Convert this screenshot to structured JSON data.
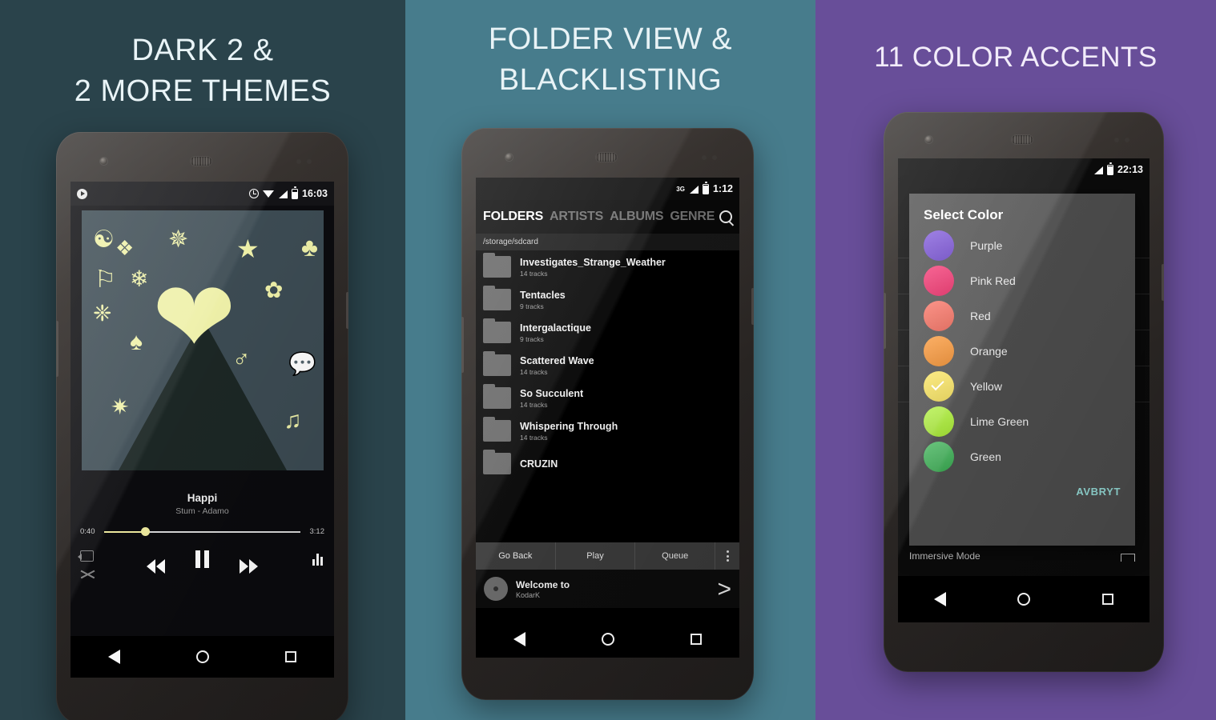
{
  "panels": [
    {
      "id": "themes",
      "bg": "#2a434b",
      "title_lines": [
        "DARK 2 &",
        "2 MORE THEMES"
      ]
    },
    {
      "id": "folders",
      "bg": "#477c8c",
      "title_lines": [
        "FOLDER VIEW &",
        "BLACKLISTING"
      ]
    },
    {
      "id": "accents",
      "bg": "#684e99",
      "title_lines": [
        "11 COLOR ACCENTS"
      ]
    }
  ],
  "phone1": {
    "statusbar": {
      "left_icon": "play-badge-icon",
      "icons": [
        "alarm-icon",
        "wifi-icon",
        "signal-icon",
        "battery-icon"
      ],
      "time": "16:03"
    },
    "album_art": {
      "bg": "#3c4b53",
      "accent": "#eef0a8",
      "symbols": [
        "☯",
        "❖",
        "☀",
        "★",
        "♣",
        "⚑",
        "✿",
        "❀",
        "✤",
        "♠",
        "♂",
        "●",
        "✹",
        "♫"
      ]
    },
    "track": {
      "title": "Happi",
      "artist": "Stum - Adamo",
      "elapsed": "0:40",
      "duration": "3:12",
      "progress_percent": 21
    },
    "controls": {
      "repeat": "repeat-icon",
      "shuffle": "shuffle-icon",
      "previous": "previous-icon",
      "playpause": "pause-icon",
      "next": "next-icon",
      "equalizer": "equalizer-icon"
    },
    "nav": [
      "back-icon",
      "home-icon",
      "recents-icon"
    ]
  },
  "phone2": {
    "statusbar": {
      "network": "3G",
      "icons": [
        "signal-icon",
        "battery-charging-icon"
      ],
      "time": "1:12"
    },
    "tabs": [
      {
        "label": "FOLDERS",
        "active": true
      },
      {
        "label": "ARTISTS",
        "active": false
      },
      {
        "label": "ALBUMS",
        "active": false
      },
      {
        "label": "GENRE",
        "active": false
      }
    ],
    "search_icon": "search-icon",
    "path": "/storage/sdcard",
    "folders": [
      {
        "name": "Investigates_Strange_Weather",
        "tracks": "14 tracks"
      },
      {
        "name": "Tentacles",
        "tracks": "9 tracks"
      },
      {
        "name": "Intergalactique",
        "tracks": "9 tracks"
      },
      {
        "name": "Scattered Wave",
        "tracks": "14 tracks"
      },
      {
        "name": "So Succulent",
        "tracks": "14 tracks"
      },
      {
        "name": "Whispering Through",
        "tracks": "14 tracks"
      },
      {
        "name": "CRUZIN",
        "tracks": ""
      }
    ],
    "actions": [
      {
        "label": "Go Back"
      },
      {
        "label": "Play"
      },
      {
        "label": "Queue"
      }
    ],
    "overflow_icon": "kebab-menu-icon",
    "now_playing": {
      "title": "Welcome to",
      "artist": "KodarK",
      "next_icon": "next-track-icon",
      "art_icon": "disc-icon"
    },
    "nav": [
      "back-icon",
      "home-icon",
      "recents-icon"
    ]
  },
  "phone3": {
    "statusbar": {
      "icons": [
        "signal-icon",
        "battery-charging-icon"
      ],
      "time": "22:13"
    },
    "dialog": {
      "title": "Select Color",
      "colors": [
        {
          "name": "Purple",
          "hex": "#6c3fd6",
          "selected": false
        },
        {
          "name": "Pink Red",
          "hex": "#f4195e",
          "selected": false
        },
        {
          "name": "Red",
          "hex": "#f9604f",
          "selected": false
        },
        {
          "name": "Orange",
          "hex": "#fa8a1e",
          "selected": false
        },
        {
          "name": "Yellow",
          "hex": "#fbe34f",
          "selected": true
        },
        {
          "name": "Lime Green",
          "hex": "#a8ef2c",
          "selected": false
        },
        {
          "name": "Green",
          "hex": "#3db256",
          "selected": false
        }
      ],
      "cancel_label": "AVBRYT",
      "cancel_color": "#8fd3cf"
    },
    "background_rows": [
      "",
      "",
      "",
      "",
      ""
    ],
    "immersive_label": "Immersive Mode",
    "immersive_icon": "immersive-toggle-icon",
    "nav": [
      "back-icon",
      "home-icon",
      "recents-icon"
    ]
  }
}
